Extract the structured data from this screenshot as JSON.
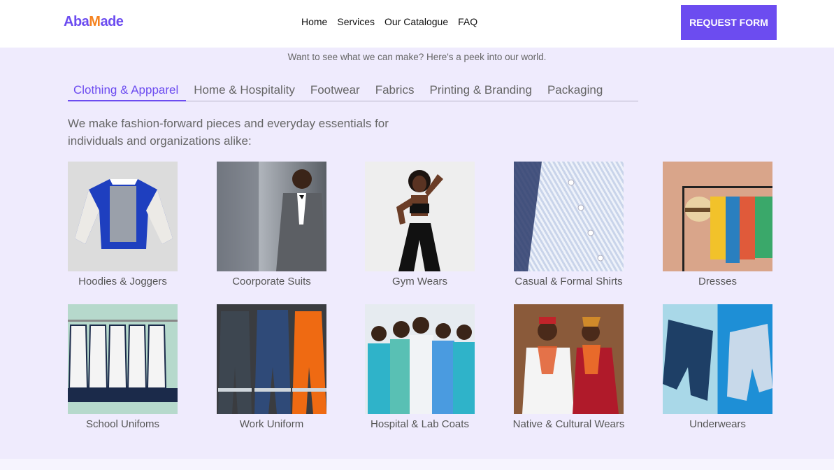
{
  "header": {
    "logo_part1": "Aba",
    "logo_part2": "M",
    "logo_part3": "ade",
    "nav": [
      "Home",
      "Services",
      "Our Catalogue",
      "FAQ"
    ],
    "cta": "REQUEST FORM"
  },
  "colors": {
    "accent": "#6c4cf0",
    "logo_orange": "#f5821f",
    "background": "#efebfd"
  },
  "main": {
    "peek": "Want to see what we can make? Here's a peek into our world.",
    "tabs": [
      "Clothing & Appparel",
      "Home & Hospitality",
      "Footwear",
      "Fabrics",
      "Printing & Branding",
      "Packaging"
    ],
    "active_tab": "Clothing & Appparel",
    "intro": "We make fashion-forward pieces and everyday essentials for individuals and organizations alike:",
    "products": [
      {
        "label": "Hoodies & Joggers",
        "icon": "varsity-jacket-photo"
      },
      {
        "label": "Coorporate Suits",
        "icon": "suit-man-photo"
      },
      {
        "label": "Gym Wears",
        "icon": "gym-woman-photo"
      },
      {
        "label": "Casual & Formal Shirts",
        "icon": "striped-shirt-photo"
      },
      {
        "label": "Dresses",
        "icon": "clothing-rack-photo"
      },
      {
        "label": "School Unifoms",
        "icon": "school-uniforms-photo"
      },
      {
        "label": "Work Uniform",
        "icon": "coveralls-photo"
      },
      {
        "label": "Hospital & Lab Coats",
        "icon": "medical-staff-photo"
      },
      {
        "label": "Native & Cultural Wears",
        "icon": "cultural-couple-photo"
      },
      {
        "label": "Underwears",
        "icon": "underwear-photo"
      }
    ]
  }
}
